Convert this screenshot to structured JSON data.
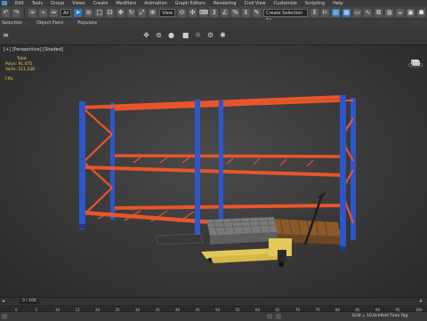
{
  "menu": {
    "items": [
      "Edit",
      "Tools",
      "Group",
      "Views",
      "Create",
      "Modifiers",
      "Animation",
      "Graph Editors",
      "Rendering",
      "Civil View",
      "Customize",
      "Scripting",
      "Help"
    ]
  },
  "toolbar": {
    "selection_dropdown": "All",
    "view_dropdown": "View",
    "selection_set_placeholder": "Create Selection Se"
  },
  "ribbon": {
    "tabs": [
      "Selection",
      "Object Paint",
      "Populate"
    ]
  },
  "viewport": {
    "label": "[+] [Perspective] [Shaded]",
    "stats": {
      "header": "Total",
      "polys_label": "Polys:",
      "polys_value": "91,075",
      "verts_label": "Verts:",
      "verts_value": "111,538",
      "fps_label": "FPS:"
    }
  },
  "timeline": {
    "frame_display": "0 / 100",
    "ruler_ticks": [
      "0",
      "5",
      "10",
      "15",
      "20",
      "25",
      "30",
      "35",
      "40",
      "45",
      "50",
      "55",
      "60",
      "65",
      "70",
      "75",
      "80",
      "85",
      "90",
      "95",
      "100"
    ]
  },
  "statusbar": {
    "coord_text": "Grid = 10,0cm",
    "addtime_label": "Add Time Tag"
  },
  "colors": {
    "rack_beam": "#e8552a",
    "rack_upright": "#2d56c8",
    "stats_text": "#e8d24a",
    "accent": "#2f76c2",
    "pallet": "#8a5a2b",
    "pallet_jack": "#e3c95a"
  },
  "icons": [
    "undo-icon",
    "redo-icon",
    "link-icon",
    "unlink-icon",
    "select-icon",
    "move-icon",
    "rotate-icon",
    "scale-icon",
    "snap-icon",
    "mirror-icon",
    "align-icon",
    "render-icon"
  ]
}
